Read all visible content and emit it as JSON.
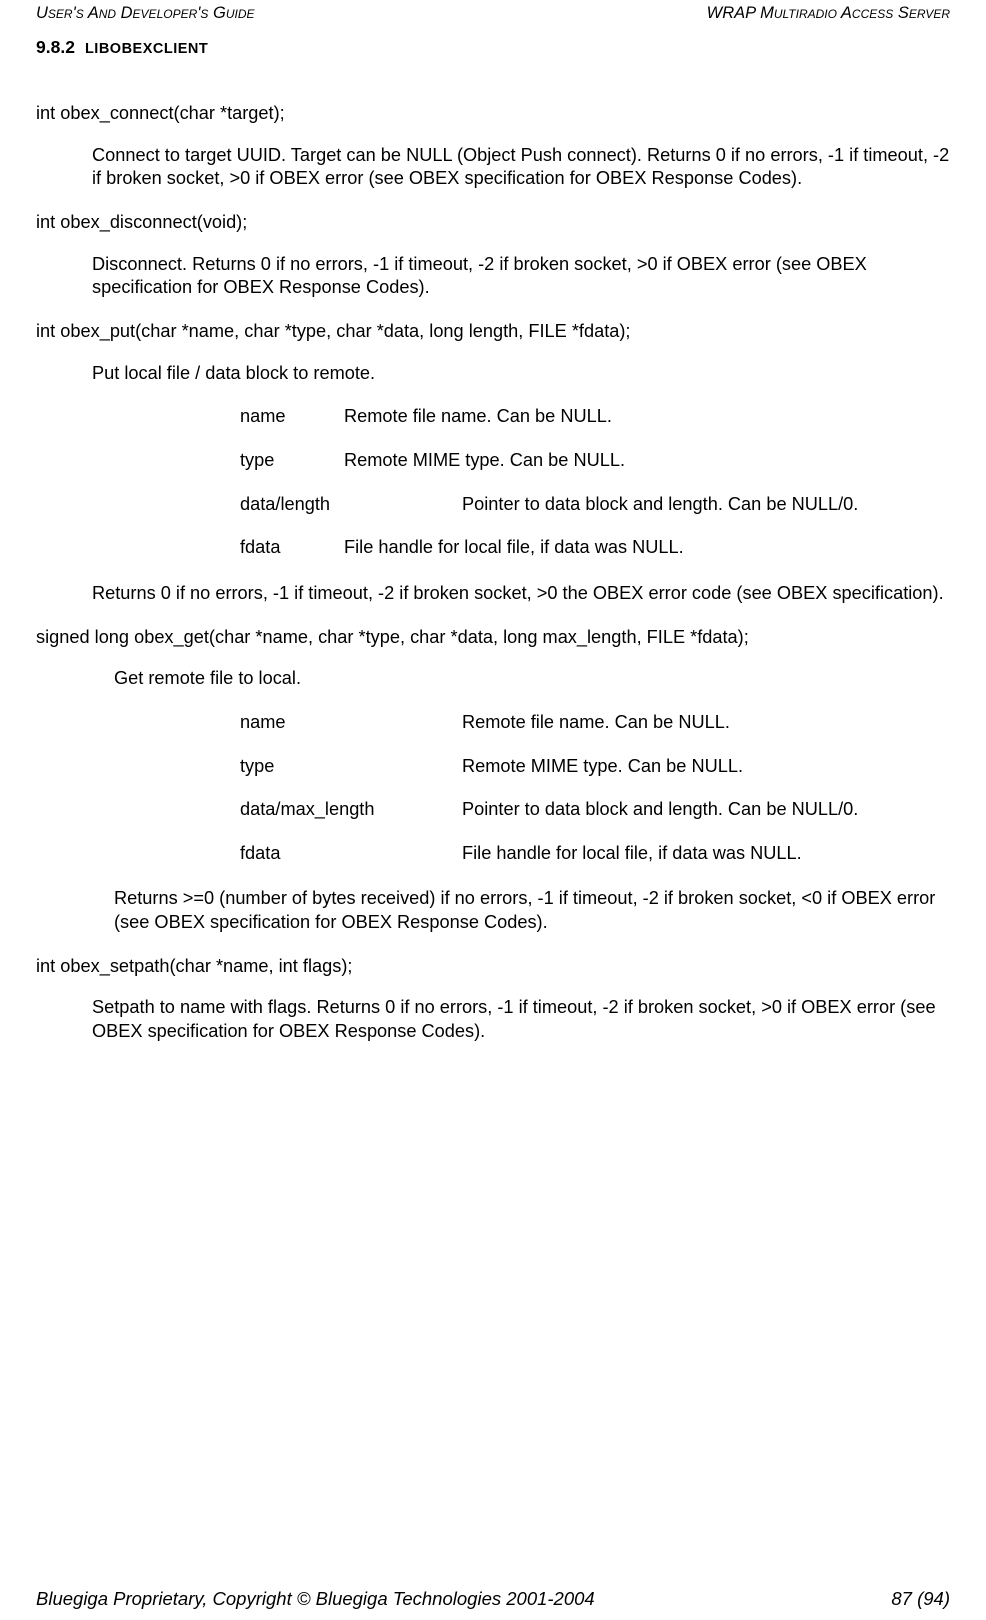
{
  "header": {
    "left": "User's And Developer's Guide",
    "right": "WRAP Multiradio Access Server"
  },
  "section": {
    "number": "9.8.2",
    "title": "LIBOBEXCLIENT"
  },
  "fn_connect": {
    "sig": "int obex_connect(char *target);",
    "desc": "Connect to target UUID. Target can be NULL (Object Push connect). Returns 0 if no errors, -1 if timeout, -2 if broken socket, >0 if OBEX error (see OBEX specification for OBEX Response Codes)."
  },
  "fn_disconnect": {
    "sig": "int obex_disconnect(void);",
    "desc": "Disconnect. Returns 0 if no errors, -1 if timeout, -2 if broken socket, >0 if OBEX error (see OBEX specification for OBEX Response Codes)."
  },
  "fn_put": {
    "sig": "int obex_put(char *name, char *type, char *data, long length, FILE *fdata);",
    "intro": "Put local file / data block to remote.",
    "params": [
      {
        "k": "name",
        "v": "Remote file name. Can be NULL.",
        "wide": false
      },
      {
        "k": "type",
        "v": "Remote MIME type. Can be NULL.",
        "wide": false
      },
      {
        "k": "data/length",
        "v": "Pointer to data block and length. Can be NULL/0.",
        "wide": true
      },
      {
        "k": "fdata",
        "v": "File handle for local file, if data was NULL.",
        "wide": false
      }
    ],
    "returns": "Returns 0 if no errors, -1 if timeout, -2 if broken socket, >0 the OBEX error code (see OBEX specification)."
  },
  "fn_get": {
    "sig": "signed long obex_get(char *name, char *type, char *data, long max_length, FILE *fdata);",
    "intro": "Get remote file to local.",
    "params": [
      {
        "k": "name",
        "v": "Remote file name. Can be NULL."
      },
      {
        "k": "type",
        "v": "Remote MIME type. Can be NULL."
      },
      {
        "k": "data/max_length",
        "v": "Pointer to data block and length. Can be NULL/0."
      },
      {
        "k": "fdata",
        "v": "File handle for local file, if data was NULL."
      }
    ],
    "returns": "Returns >=0 (number of bytes received) if no errors, -1 if timeout, -2 if broken socket, <0 if OBEX error (see OBEX specification for OBEX Response Codes)."
  },
  "fn_setpath": {
    "sig": "int obex_setpath(char *name, int flags);",
    "desc": "Setpath to name with flags. Returns 0 if no errors, -1 if timeout, -2 if broken socket, >0 if OBEX error (see OBEX specification for OBEX Response Codes)."
  },
  "footer": {
    "left": "Bluegiga Proprietary, Copyright © Bluegiga Technologies 2001-2004",
    "right": "87 (94)"
  }
}
